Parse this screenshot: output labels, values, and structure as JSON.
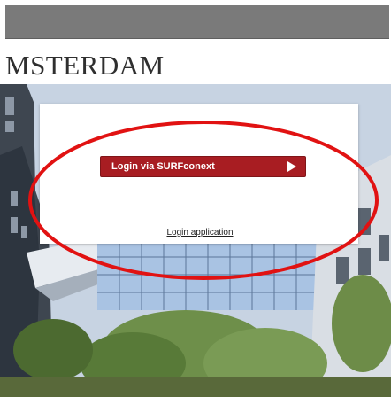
{
  "header": {
    "institution_text": "MSTERDAM"
  },
  "login": {
    "button_label": "Login via SURFconext",
    "arrow_icon": "play-arrow-icon",
    "app_link_label": "Login application"
  },
  "colors": {
    "button_red": "#a81d22",
    "annotation_red": "#e11212",
    "header_band": "#7a7a7a"
  }
}
